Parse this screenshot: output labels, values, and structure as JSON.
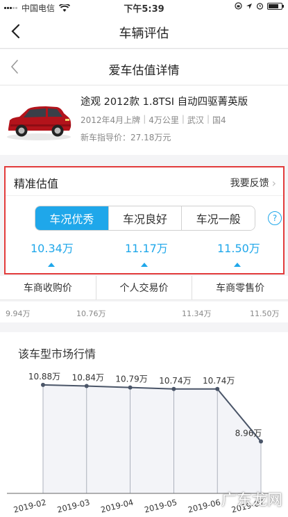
{
  "status_bar": {
    "carrier": "中国电信",
    "time": "下午5:39"
  },
  "nav": {
    "title": "车辆评估"
  },
  "sub_header": {
    "title": "爱车估值详情"
  },
  "car": {
    "name": "途观 2012款 1.8TSI 自动四驱菁英版",
    "meta": [
      "2012年4月上牌",
      "4万公里",
      "武汉",
      "国4"
    ],
    "guide_price": "新车指导价：27.18万元"
  },
  "estimate": {
    "title": "精准估值",
    "feedback": "我要反馈",
    "tabs": [
      "车况优秀",
      "车况良好",
      "车况一般"
    ],
    "active_tab": 0,
    "help": "?",
    "values": [
      "10.34万",
      "11.17万",
      "11.50万"
    ]
  },
  "reference": {
    "labels": [
      "车商收购价",
      "个人交易价",
      "车商零售价"
    ],
    "scale": [
      "9.94万",
      "10.76万",
      "11.34万",
      "11.50万"
    ]
  },
  "market": {
    "title": "该车型市场行情",
    "watermark": "广东龙网"
  },
  "chart_data": {
    "type": "area",
    "x": [
      "2019-02",
      "2019-03",
      "2019-04",
      "2019-05",
      "2019-06",
      "2019-07"
    ],
    "tick_labels": [
      "2019-02",
      "2019-03",
      "2019-04",
      "2019-05",
      "2019-06",
      "2019-07"
    ],
    "values": [
      10.88,
      10.84,
      10.79,
      10.74,
      10.74,
      8.96
    ],
    "data_labels": [
      "10.88万",
      "10.84万",
      "10.79万",
      "10.74万",
      "10.74万",
      "8.96万"
    ],
    "ylim": [
      7.2,
      11.3
    ],
    "line_color": "#4a5568",
    "fill_color": "#f3f4f8",
    "grid": false
  },
  "colors": {
    "accent": "#1fa7ea",
    "highlight_border": "#e23b3b"
  }
}
